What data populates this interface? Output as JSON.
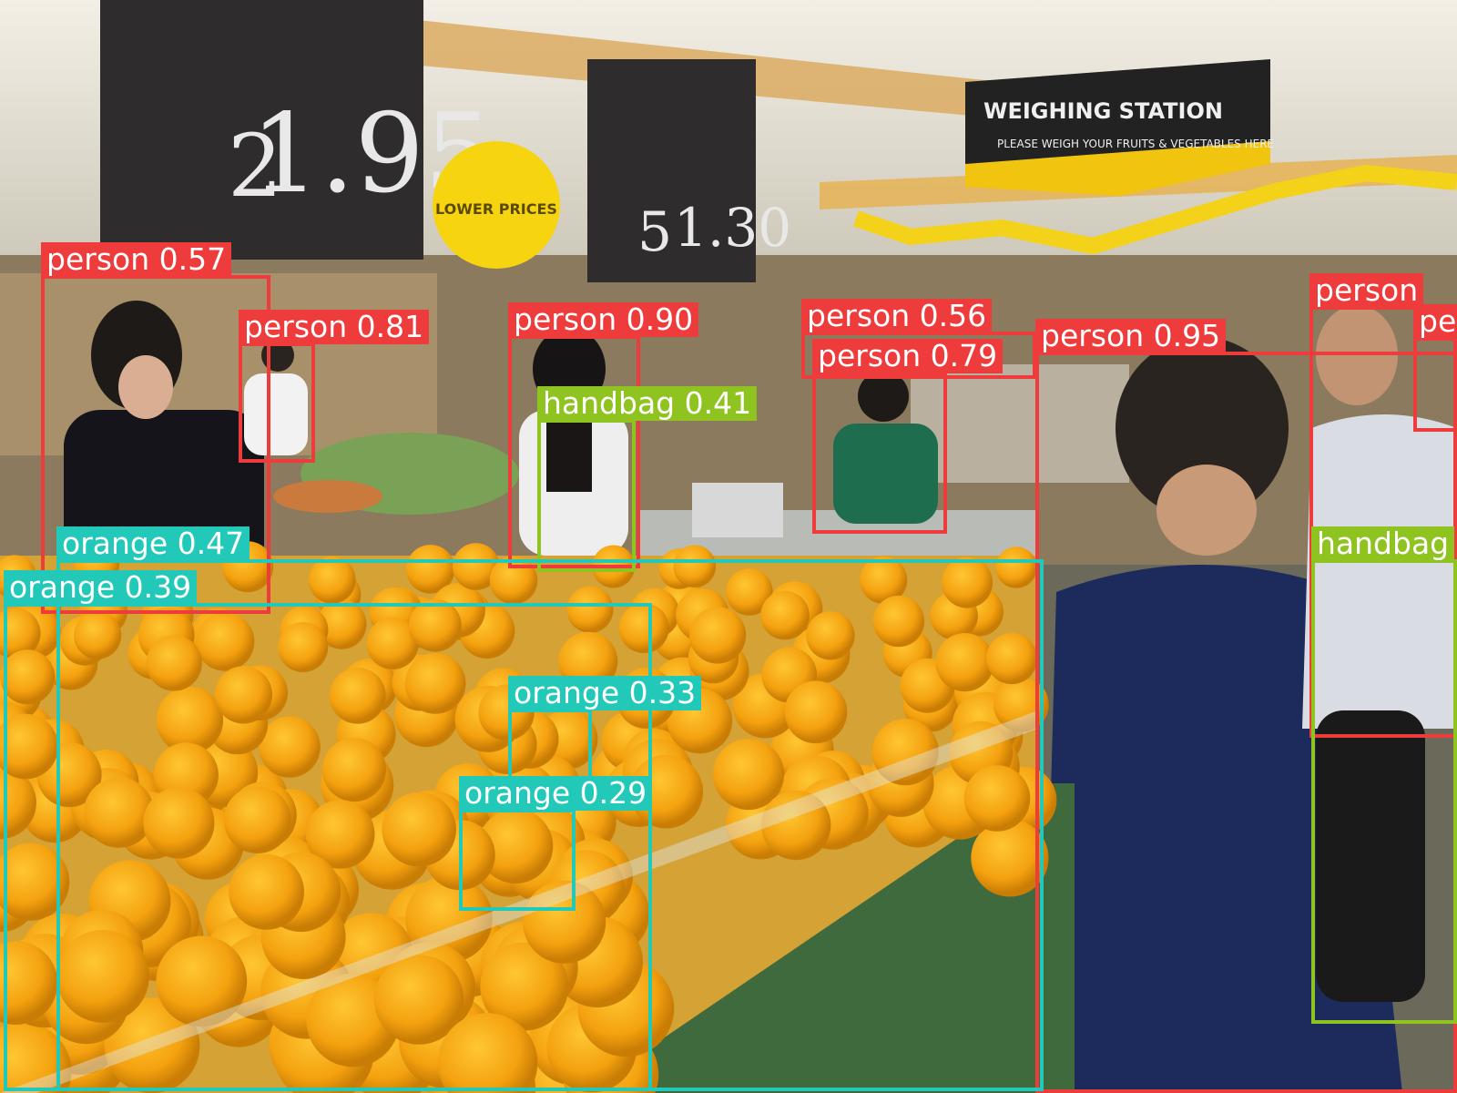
{
  "palette": {
    "person": "#ee3b3b",
    "handbag": "#8fc31f",
    "orange": "#22c9b8"
  },
  "scene": {
    "signs": {
      "price_left_text": "1.95",
      "price_left_prefix": "2",
      "price_mid_text": "1.30",
      "price_mid_prefix": "5",
      "badge_text": "LOWER PRICES",
      "weigh_title": "WEIGHING STATION",
      "weigh_sub": "PLEASE WEIGH YOUR FRUITS & VEGETABLES HERE"
    }
  },
  "detections": [
    {
      "cls": "person",
      "label": "person 0.57"
    },
    {
      "cls": "person",
      "label": "person 0.81"
    },
    {
      "cls": "person",
      "label": "person 0.90"
    },
    {
      "cls": "handbag",
      "label": "handbag 0.41"
    },
    {
      "cls": "person",
      "label": "person 0.56"
    },
    {
      "cls": "person",
      "label": "person 0.79"
    },
    {
      "cls": "person",
      "label": "person 0.95"
    },
    {
      "cls": "person",
      "label": "person"
    },
    {
      "cls": "person",
      "label": "pe"
    },
    {
      "cls": "handbag",
      "label": "handbag"
    },
    {
      "cls": "orange",
      "label": "orange 0.47"
    },
    {
      "cls": "orange",
      "label": "orange 0.39"
    },
    {
      "cls": "orange",
      "label": "orange 0.33"
    },
    {
      "cls": "orange",
      "label": "orange 0.29"
    }
  ]
}
